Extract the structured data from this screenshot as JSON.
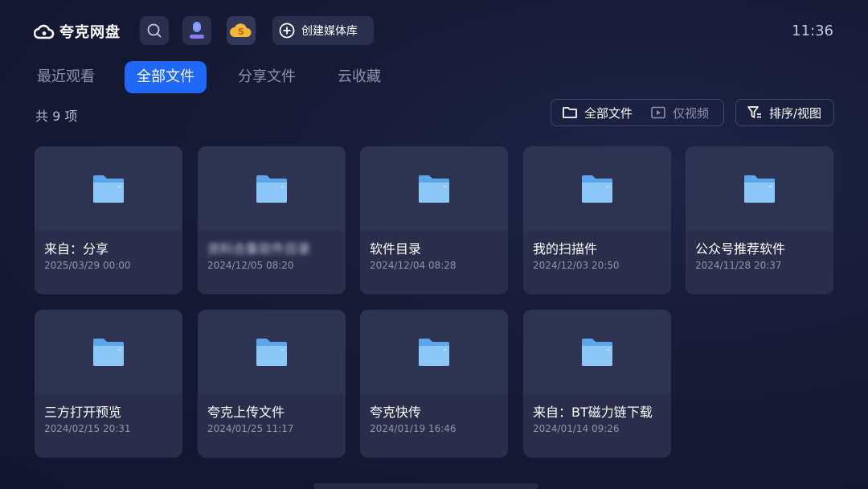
{
  "app": {
    "title": "夸克网盘"
  },
  "header": {
    "create_label": "创建媒体库",
    "time": "11:36"
  },
  "tabs": [
    {
      "label": "最近观看",
      "active": false
    },
    {
      "label": "全部文件",
      "active": true
    },
    {
      "label": "分享文件",
      "active": false
    },
    {
      "label": "云收藏",
      "active": false
    }
  ],
  "list": {
    "count_text": "共 9 项"
  },
  "filters": {
    "all_files_label": "全部文件",
    "video_only_label": "仅视频",
    "sort_label": "排序/视图"
  },
  "folders": [
    {
      "name": "来自：分享",
      "date": "2025/03/29 00:00"
    },
    {
      "name": "资料合集软件目录",
      "date": "2024/12/05 08:20",
      "blurred": true
    },
    {
      "name": "软件目录",
      "date": "2024/12/04 08:28"
    },
    {
      "name": "我的扫描件",
      "date": "2024/12/03 20:50"
    },
    {
      "name": "公众号推荐软件",
      "date": "2024/11/28 20:37"
    },
    {
      "name": "三方打开预览",
      "date": "2024/02/15 20:31"
    },
    {
      "name": "夸克上传文件",
      "date": "2024/01/25 11:17"
    },
    {
      "name": "夸克快传",
      "date": "2024/01/19 16:46"
    },
    {
      "name": "来自：BT磁力链下载",
      "date": "2024/01/14 09:26"
    }
  ],
  "colors": {
    "accent": "#1f67f5",
    "background": "#161a35",
    "card": "#2a2e4b",
    "folder": "#7fbef4"
  }
}
